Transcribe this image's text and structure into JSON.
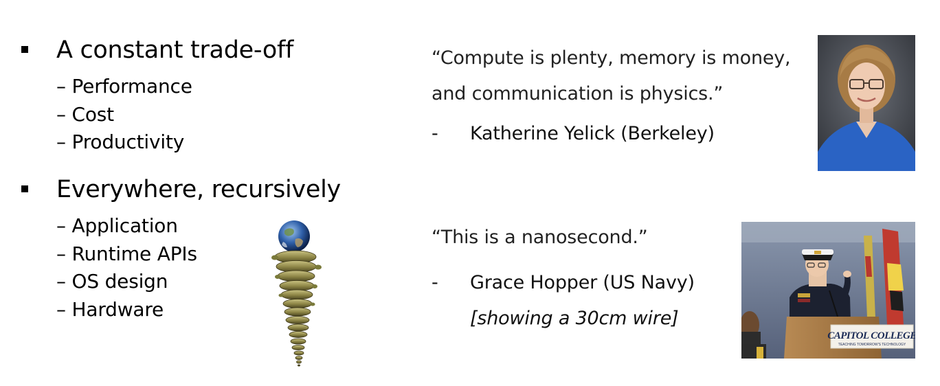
{
  "left": {
    "bullet1": {
      "heading": "A constant trade-off",
      "items": [
        "– Performance",
        "– Cost",
        "– Productivity"
      ]
    },
    "bullet2": {
      "heading": "Everywhere, recursively",
      "items": [
        "– Application",
        "– Runtime APIs",
        "– OS design",
        "– Hardware"
      ]
    }
  },
  "quote1": {
    "line1": "“Compute is plenty, memory is money,",
    "line2": "and communication is physics.”",
    "dash": "-",
    "attribution": "Katherine Yelick (Berkeley)"
  },
  "quote2": {
    "line1": "“This is a nanosecond.”",
    "dash": "-",
    "attribution": "Grace Hopper (US Navy)",
    "note": "[showing a 30cm wire]"
  },
  "hopper_photo": {
    "podium_sign_line1": "CAPITOL COLLEGE",
    "podium_sign_line2": "TEACHING TOMORROW'S TECHNOLOGY"
  }
}
